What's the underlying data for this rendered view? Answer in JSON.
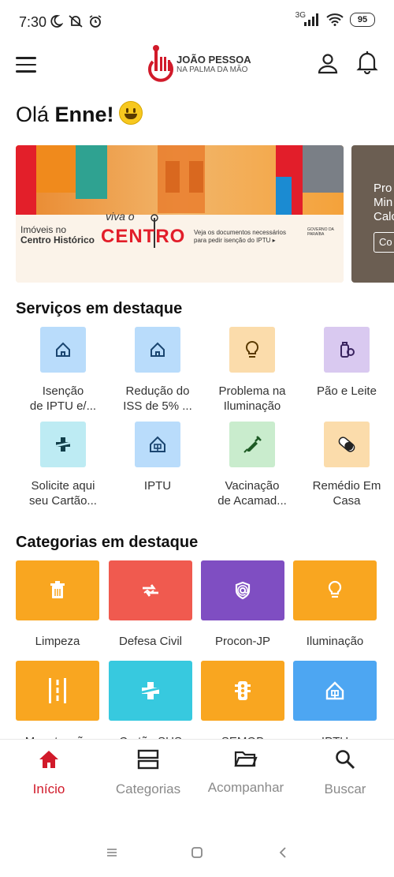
{
  "status": {
    "time": "7:30",
    "network": "3G",
    "battery": "95"
  },
  "header": {
    "logo_title": "JOÃO PESSOA",
    "logo_sub": "NA PALMA DA MÃO"
  },
  "greeting": {
    "prefix": "Olá ",
    "name": "Enne!"
  },
  "banner": {
    "text1": "Imóveis no",
    "text2": "Centro Histórico",
    "viva": "viva o",
    "centro": "CENTRO",
    "note": "Veja os documentos necessários para pedir isenção do IPTU ▸",
    "gov": "GOVERNO DA PARAÍBA"
  },
  "banner2": {
    "line1": "Pro",
    "line2": "Min",
    "line3": "Calc",
    "button": "Co"
  },
  "services_title": "Serviços em destaque",
  "services": [
    {
      "label1": "Isenção",
      "label2": "de IPTU e/...",
      "icon": "house-icon",
      "color": "#b9dcfb"
    },
    {
      "label1": "Redução do",
      "label2": "ISS de 5% ...",
      "icon": "house-icon",
      "color": "#b9dcfb"
    },
    {
      "label1": "Problema na",
      "label2": "Iluminação",
      "icon": "lightbulb-icon",
      "color": "#fbdcab"
    },
    {
      "label1": "Pão e Leite",
      "label2": "",
      "icon": "baby-bottle-icon",
      "color": "#d9c9f0"
    },
    {
      "label1": "Solicite aqui",
      "label2": "seu Cartão...",
      "icon": "medical-cross-icon",
      "color": "#bdebf3"
    },
    {
      "label1": "IPTU",
      "label2": "",
      "icon": "house-icon",
      "color": "#b9dcfb"
    },
    {
      "label1": "Vacinação",
      "label2": "de Acamad...",
      "icon": "syringe-icon",
      "color": "#c9eccd"
    },
    {
      "label1": "Remédio Em",
      "label2": "Casa",
      "icon": "pill-icon",
      "color": "#fbdcab"
    }
  ],
  "categories_title": "Categorias em destaque",
  "categories": [
    {
      "label": "Limpeza",
      "icon": "trash-icon",
      "color": "#f9a620"
    },
    {
      "label": "Defesa Civil",
      "icon": "defesa-icon",
      "color": "#f05a4f"
    },
    {
      "label": "Procon-JP",
      "icon": "shield-at-icon",
      "color": "#7f4ec2"
    },
    {
      "label": "Iluminação",
      "icon": "lightbulb-icon",
      "color": "#f9a620"
    },
    {
      "label": "Manutenção",
      "icon": "road-icon",
      "color": "#f9a620"
    },
    {
      "label": "Cartão SUS",
      "icon": "medical-cross-icon",
      "color": "#37c9df"
    },
    {
      "label": "SEMOB",
      "icon": "traffic-light-icon",
      "color": "#f9a620"
    },
    {
      "label": "IPTU",
      "icon": "house-icon",
      "color": "#4da6f2"
    }
  ],
  "nav": [
    {
      "label": "Início",
      "icon": "home-icon"
    },
    {
      "label": "Categorias",
      "icon": "categories-icon"
    },
    {
      "label": "Acompanhar",
      "icon": "folder-icon"
    },
    {
      "label": "Buscar",
      "icon": "search-icon"
    }
  ],
  "colors": {
    "accent": "#d11a2a"
  }
}
